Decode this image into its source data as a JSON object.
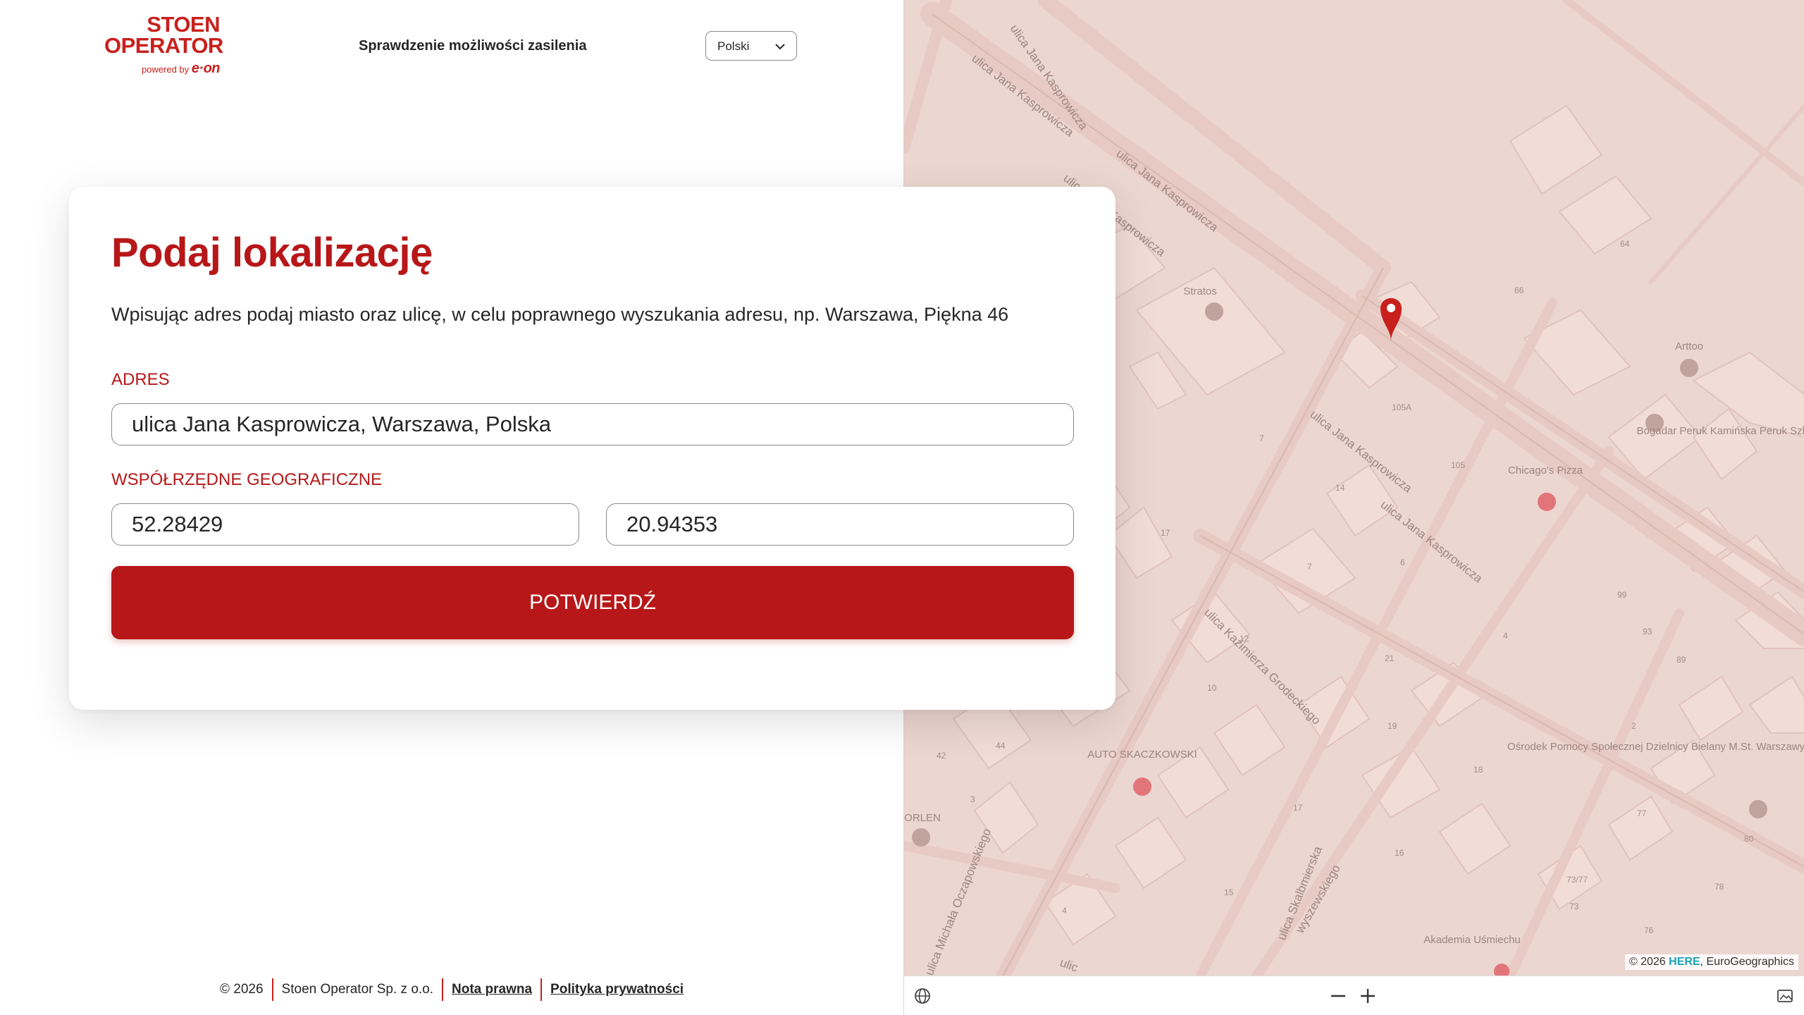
{
  "header": {
    "logo": {
      "line1": "STOEN",
      "line2": "OPERATOR",
      "powered_by": "powered by",
      "brand": "e·on"
    },
    "title": "Sprawdzenie możliwości zasilenia",
    "language": {
      "selected": "Polski"
    }
  },
  "form": {
    "title": "Podaj lokalizację",
    "description": "Wpisując adres podaj miasto oraz ulicę, w celu poprawnego wyszukania adresu, np. Warszawa, Piękna 46",
    "address_label": "ADRES",
    "address_value": "ulica Jana Kasprowicza, Warszawa, Polska",
    "coords_label": "WSPÓŁRZĘDNE GEOGRAFICZNE",
    "latitude": "52.28429",
    "longitude": "20.94353",
    "confirm_label": "POTWIERDŹ"
  },
  "footer": {
    "copyright": "© 2026",
    "company": "Stoen Operator Sp. z o.o.",
    "legal_link": "Nota prawna",
    "privacy_link": "Polityka prywatności"
  },
  "map": {
    "attribution_prefix": "© 2026 ",
    "attribution_brand": "HERE",
    "attribution_suffix": ", EuroGeographics",
    "tint_color": "#ecd6d0",
    "pin_color": "#c8201d",
    "street_labels": [
      "ulica Jana Kasprowicza",
      "ulica Jana Kasprowicza",
      "ulica Jana Kasprowicza",
      "ulica Jana Kasprowicza",
      "ulica Jana Kasprowicza",
      "ulica Jana Kasprowicza",
      "ulica Kazimierza Grodeckiego",
      "ulica Michała Oczapowskiego",
      "ulica Skalbmierska",
      "wyszewskiego",
      "ulic"
    ],
    "poi": [
      "Stratos",
      "Arttoo",
      "Chicago's Pizza",
      "AUTO SKACZKOWSKI",
      "ORLEN",
      "Akademia Uśmiechu",
      "Bogadar Peruk Kamińska Peruk Szl",
      "Ośrodek Pomocy Społecznej Dzielnicy Bielany M.St. Warszawy"
    ],
    "house_numbers": [
      "64",
      "66",
      "105A",
      "105",
      "7",
      "14",
      "17",
      "12",
      "10",
      "6",
      "7",
      "21",
      "4",
      "99",
      "93",
      "89",
      "19",
      "18",
      "2",
      "17",
      "16",
      "15",
      "42",
      "44",
      "3",
      "4",
      "73/77",
      "73",
      "77",
      "78",
      "80",
      "76"
    ]
  }
}
